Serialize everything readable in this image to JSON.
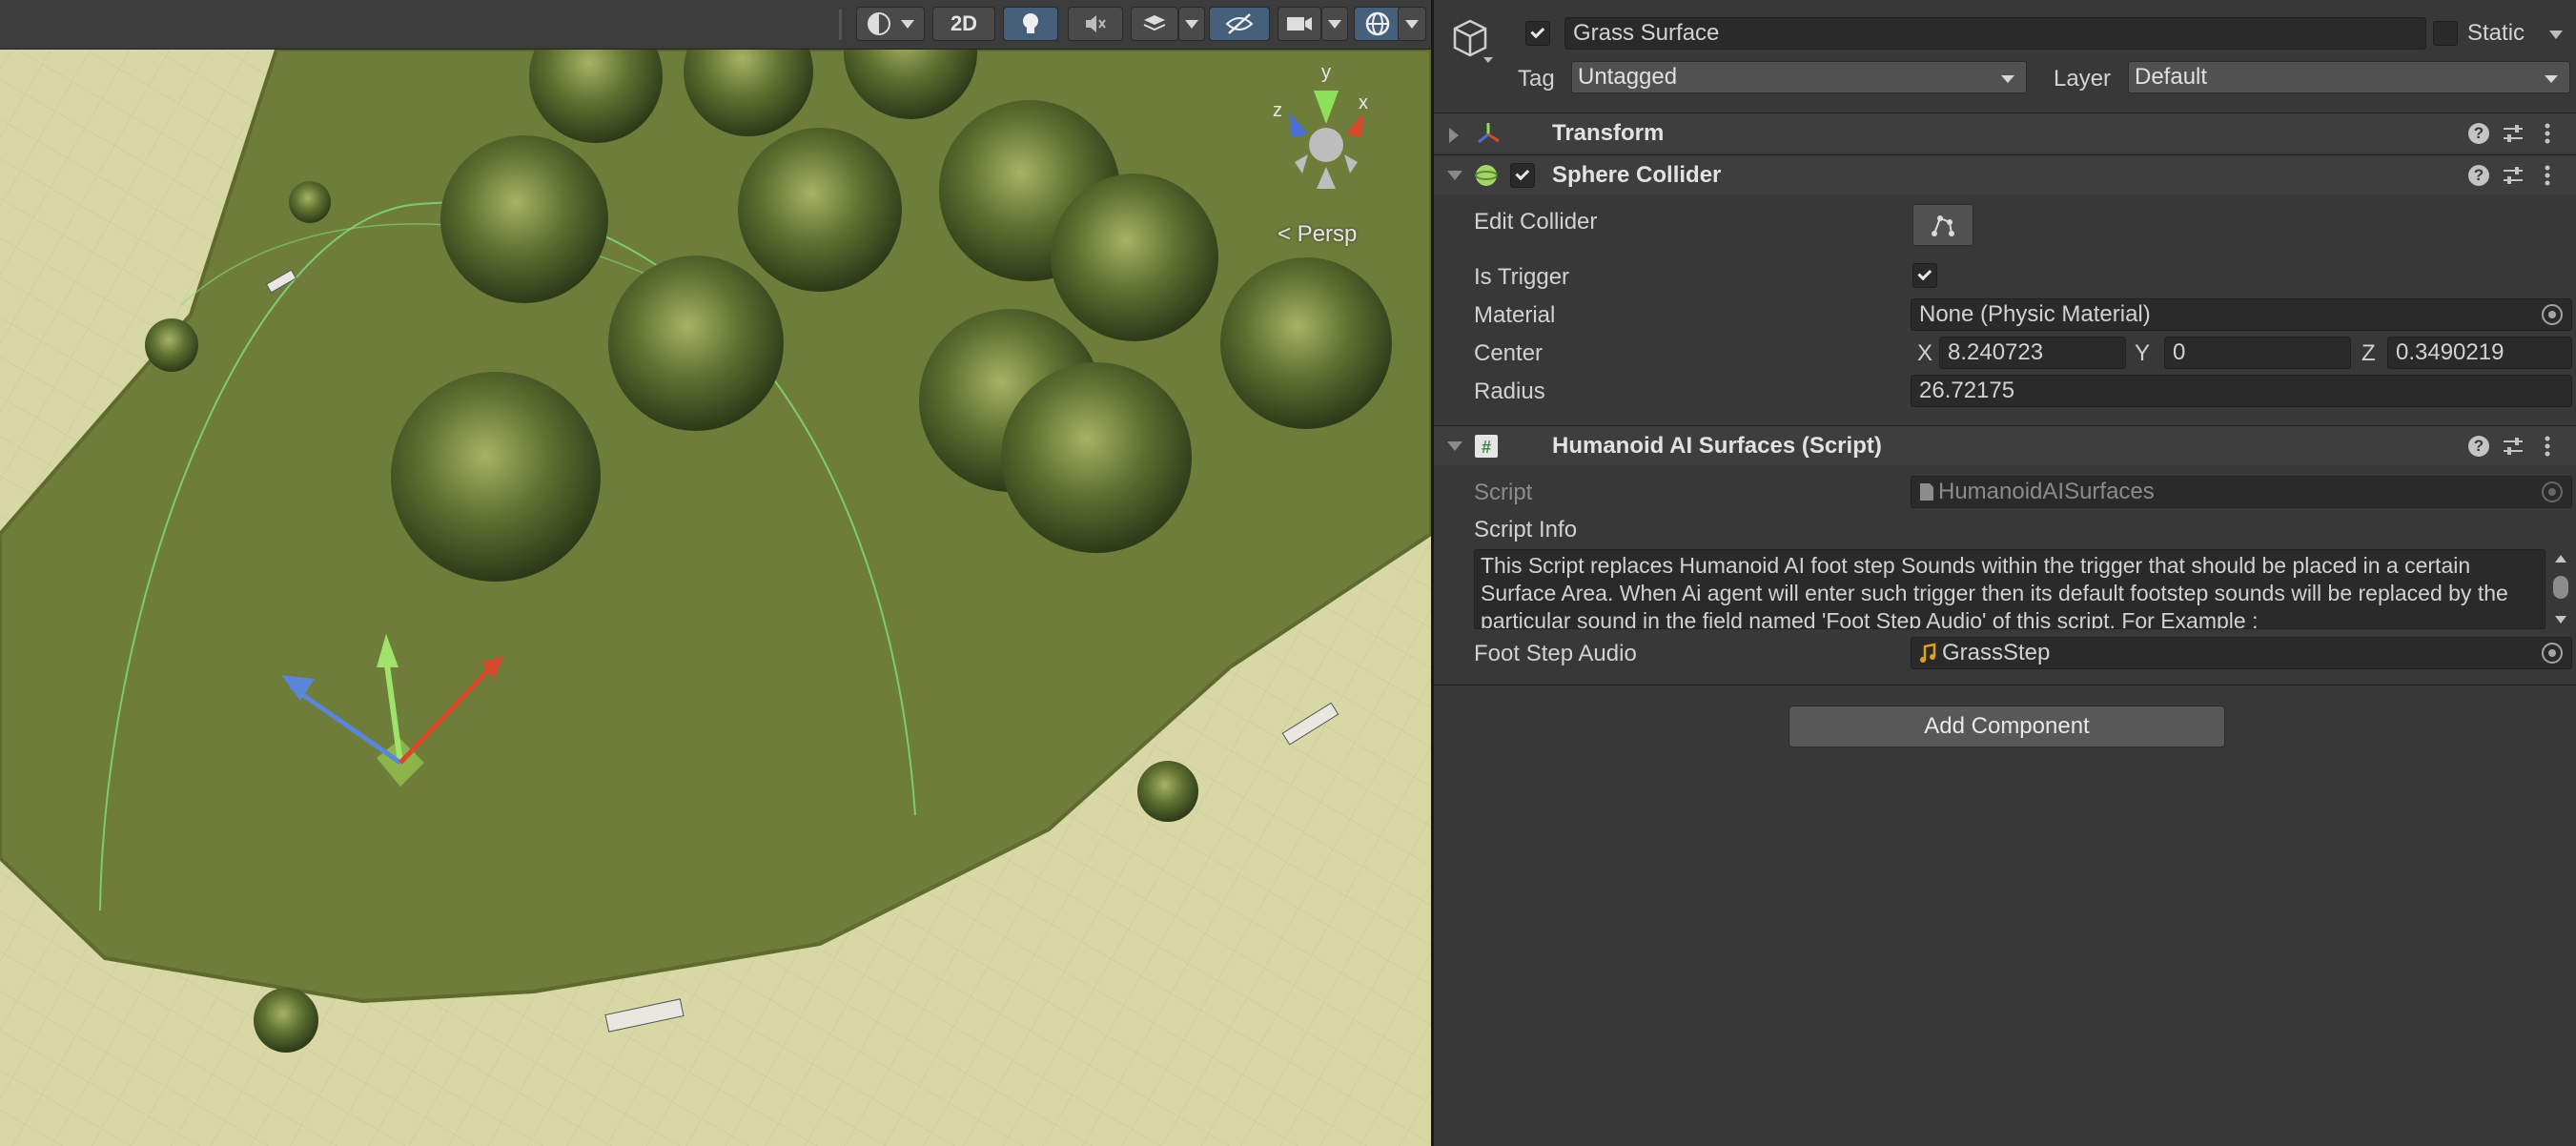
{
  "scene": {
    "toolbar": {
      "shading_icon": "shading-mode-icon",
      "mode_2d_label": "2D",
      "lighting_icon": "lightbulb-icon",
      "audio_icon": "audio-mute-icon",
      "effects_icon": "effects-layers-icon",
      "hidden_icon": "visibility-hidden-icon",
      "camera_icon": "camera-icon",
      "gizmos_icon": "gizmo-globe-icon"
    },
    "projection_label": "< Persp",
    "gizmo_axes": {
      "x": "x",
      "y": "y",
      "z": "z"
    }
  },
  "inspector": {
    "object": {
      "name": "Grass Surface",
      "active": true,
      "static_label": "Static",
      "static_checked": false,
      "tag_label": "Tag",
      "tag_value": "Untagged",
      "layer_label": "Layer",
      "layer_value": "Default"
    },
    "transform": {
      "title": "Transform"
    },
    "sphere_collider": {
      "title": "Sphere Collider",
      "enabled": true,
      "edit_collider_label": "Edit Collider",
      "is_trigger_label": "Is Trigger",
      "is_trigger": true,
      "material_label": "Material",
      "material_value": "None (Physic Material)",
      "center_label": "Center",
      "center_x_label": "X",
      "center_x": "8.240723",
      "center_y_label": "Y",
      "center_y": "0",
      "center_z_label": "Z",
      "center_z": "0.3490219",
      "radius_label": "Radius",
      "radius_value": "26.72175"
    },
    "humanoid_script": {
      "title": "Humanoid AI Surfaces (Script)",
      "script_label": "Script",
      "script_value": "HumanoidAISurfaces",
      "script_info_label": "Script Info",
      "script_info_text": "This Script replaces Humanoid AI foot step Sounds within the trigger that should be placed in a certain Surface Area. When Ai agent will enter such trigger then its default footstep sounds will be replaced by the particular sound in the field named 'Foot Step Audio' of this script. For Example :",
      "foot_step_label": "Foot Step Audio",
      "foot_step_value": "GrassStep"
    },
    "add_component_label": "Add Component"
  },
  "colors": {
    "panel_bg": "#383838",
    "field_bg": "#2a2a2a",
    "toggle_active": "#46607c",
    "grass": "#6f7d3a",
    "ground": "#d7d6a4"
  }
}
